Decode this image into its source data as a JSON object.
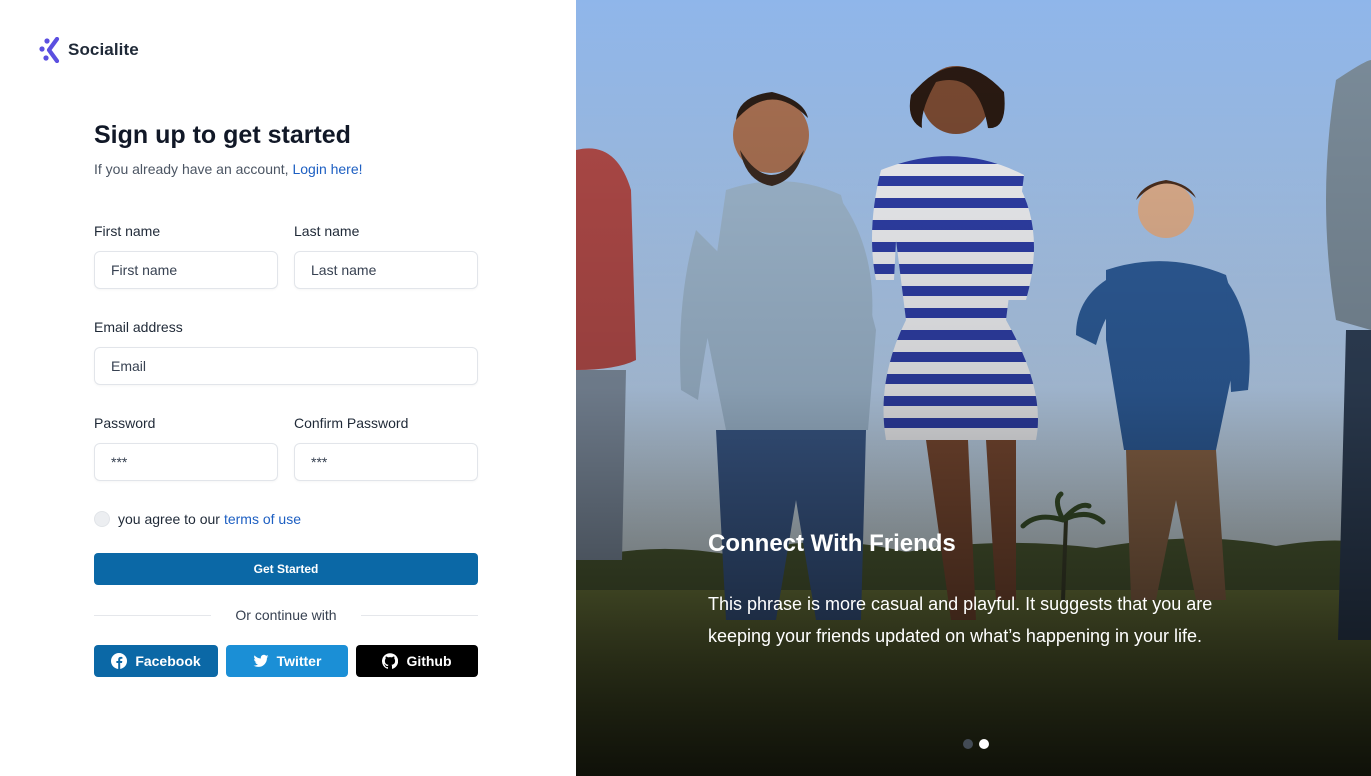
{
  "brand": {
    "name": "Socialite",
    "logo_icon": "logo-icon",
    "accent": "#5b4fe0"
  },
  "signup": {
    "title": "Sign up to get started",
    "subtitle_prefix": "If you already have an account,",
    "login_link": "Login here!",
    "first_name": {
      "label": "First name",
      "placeholder": "First name"
    },
    "last_name": {
      "label": "Last name",
      "placeholder": "Last name"
    },
    "email": {
      "label": "Email address",
      "placeholder": "Email"
    },
    "password": {
      "label": "Password",
      "placeholder": "***"
    },
    "confirm_password": {
      "label": "Confirm Password",
      "placeholder": "***"
    },
    "terms_prefix": "you agree to our",
    "terms_link": "terms of use",
    "submit_label": "Get Started",
    "divider_text": "Or continue with",
    "social": {
      "facebook": {
        "label": "Facebook",
        "icon": "facebook-icon",
        "color": "#0b68a6"
      },
      "twitter": {
        "label": "Twitter",
        "icon": "twitter-icon",
        "color": "#1b8fd6"
      },
      "github": {
        "label": "Github",
        "icon": "github-icon",
        "color": "#000000"
      }
    }
  },
  "slider": {
    "title": "Connect With Friends",
    "text": "This phrase is more casual and playful. It suggests that you are keeping your friends updated on what’s happening in your life.",
    "active_slide": 2,
    "slide_count": 2
  }
}
